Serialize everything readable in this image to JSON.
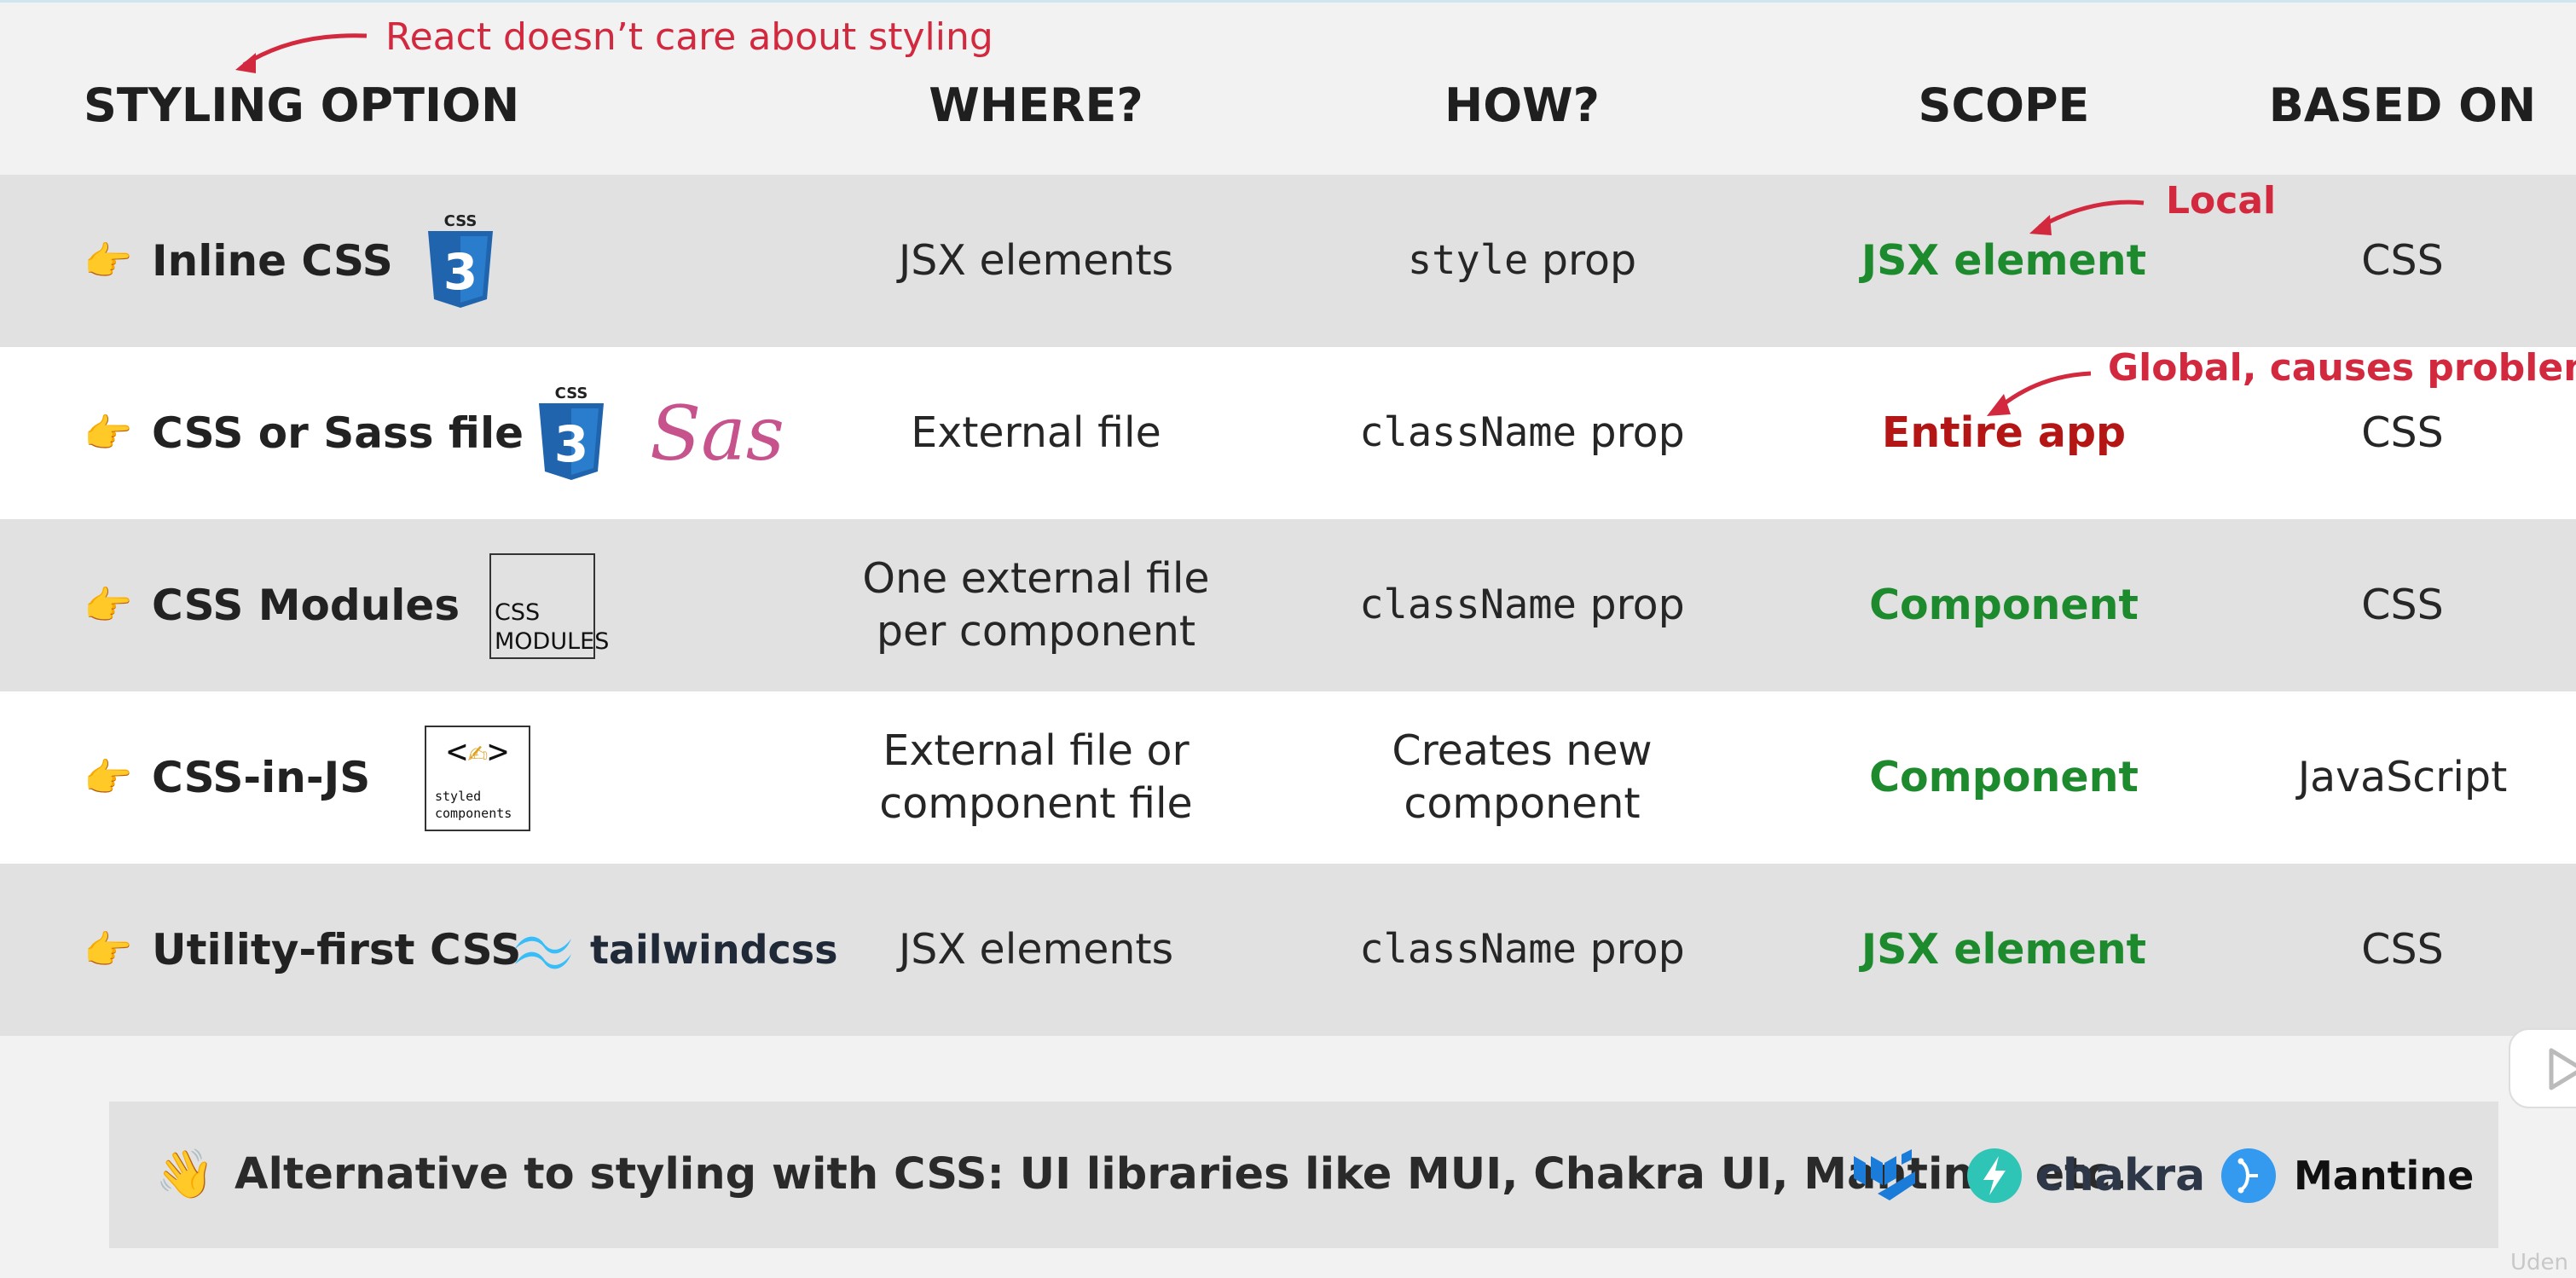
{
  "annotations": {
    "top": "React doesn’t care about styling",
    "local": "Local",
    "global": "Global, causes problems"
  },
  "headers": {
    "option": "STYLING OPTION",
    "where": "WHERE?",
    "how": "HOW?",
    "scope": "SCOPE",
    "based_on": "BASED ON"
  },
  "rows": [
    {
      "option": "Inline CSS",
      "where": "JSX elements",
      "how_code": "style",
      "how_text": " prop",
      "scope": "JSX element",
      "scope_color": "#1e8a2e",
      "based_on": "CSS"
    },
    {
      "option": "CSS or Sass file",
      "where": "External file",
      "how_code": "className",
      "how_text": " prop",
      "scope": "Entire app",
      "scope_color": "#b41616",
      "based_on": "CSS"
    },
    {
      "option": "CSS Modules",
      "where_line1": "One external file",
      "where_line2": "per component",
      "how_code": "className",
      "how_text": " prop",
      "scope": "Component",
      "scope_color": "#1e8a2e",
      "based_on": "CSS"
    },
    {
      "option": "CSS-in-JS",
      "where_line1": "External file or",
      "where_line2": "component file",
      "how_line1": "Creates new",
      "how_line2": "component",
      "scope": "Component",
      "scope_color": "#1e8a2e",
      "based_on": "JavaScript"
    },
    {
      "option": "Utility-first CSS",
      "where": "JSX elements",
      "how_code": "className",
      "how_text": " prop",
      "scope": "JSX element",
      "scope_color": "#1e8a2e",
      "based_on": "CSS"
    }
  ],
  "logos": {
    "css3": "CSS",
    "sass": "Sass",
    "css_modules_line1": "CSS",
    "css_modules_line2": "MODULES",
    "styled_line1": "styled",
    "styled_line2": "components",
    "tailwind": "tailwindcss",
    "chakra": "chakra",
    "mantine": "Mantine"
  },
  "bottom": {
    "text": "Alternative to styling with CSS: UI libraries like MUI, Chakra UI, Mantine, etc."
  },
  "watermark": "Uden"
}
